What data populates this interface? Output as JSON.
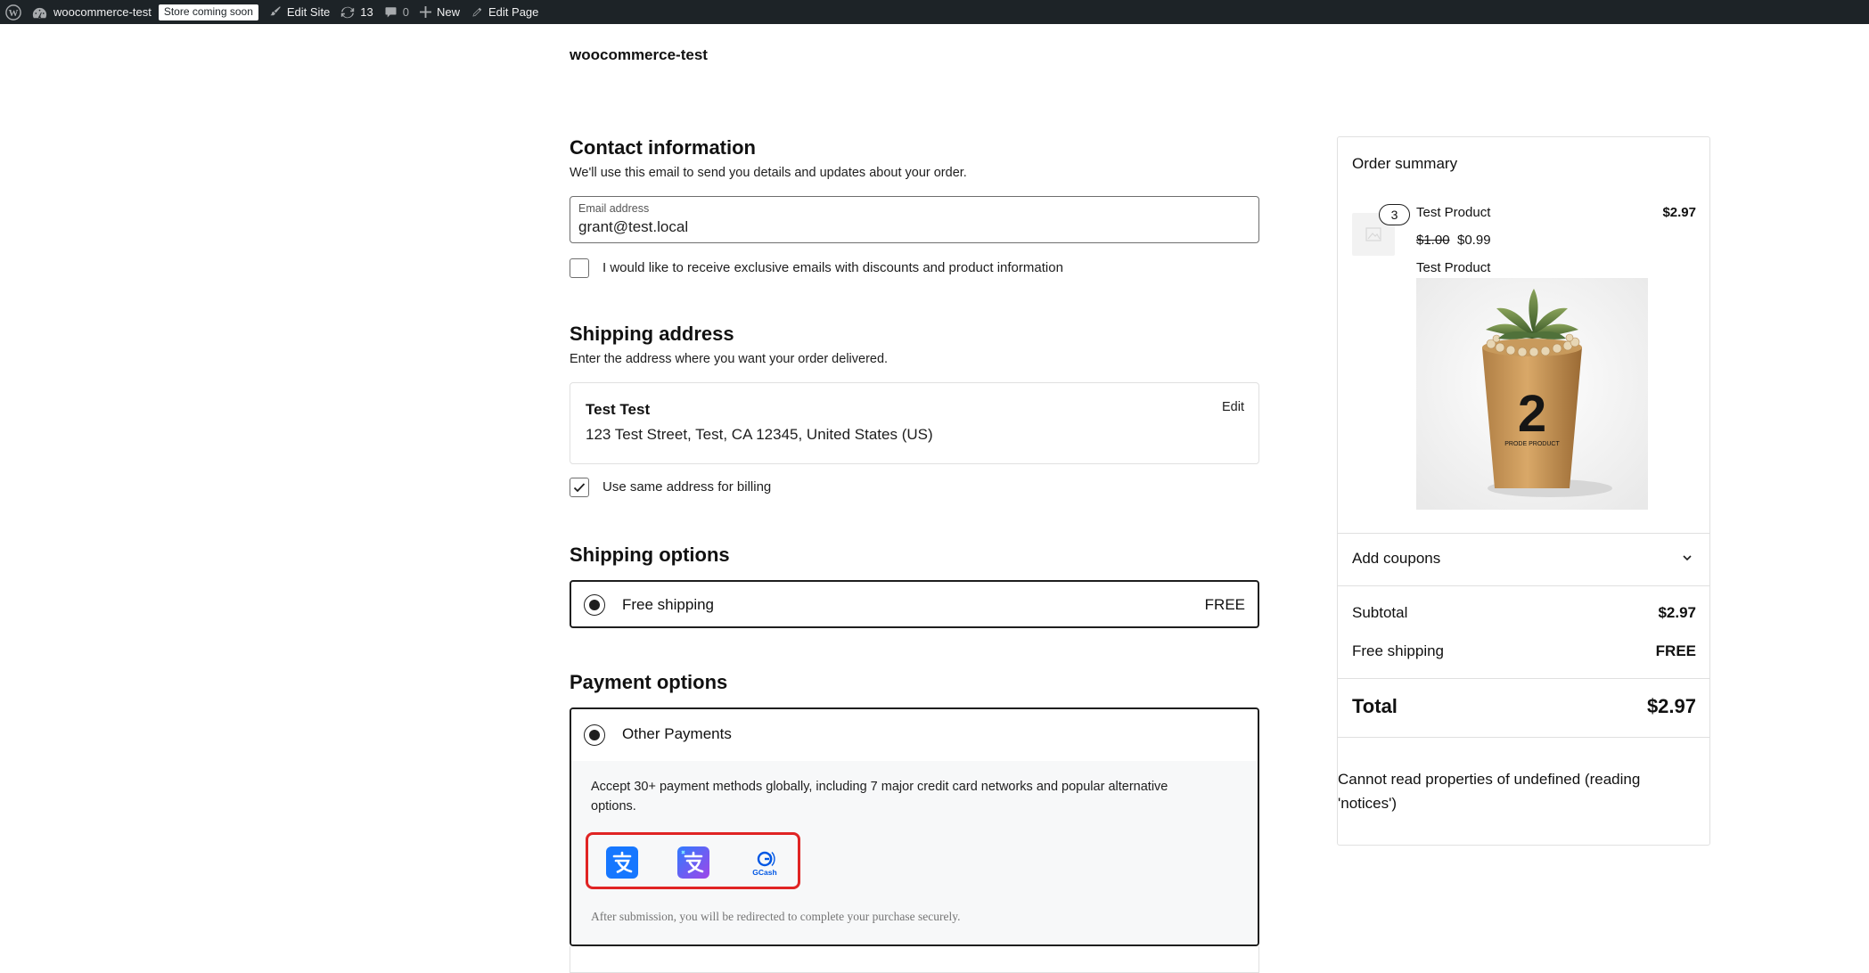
{
  "admin_bar": {
    "site_name": "woocommerce-test",
    "badge": "Store coming soon",
    "edit_site": "Edit Site",
    "updates_count": "13",
    "comments_count": "0",
    "new_label": "New",
    "edit_page": "Edit Page"
  },
  "site_title": "woocommerce-test",
  "contact": {
    "heading": "Contact information",
    "description": "We'll use this email to send you details and updates about your order.",
    "email_label": "Email address",
    "email_value": "grant@test.local",
    "newsletter_label": "I would like to receive exclusive emails with discounts and product information",
    "newsletter_checked": false
  },
  "shipping_address": {
    "heading": "Shipping address",
    "description": "Enter the address where you want your order delivered.",
    "name": "Test Test",
    "address": "123 Test Street, Test, CA 12345, United States (US)",
    "edit_label": "Edit",
    "same_billing_label": "Use same address for billing",
    "same_billing_checked": true
  },
  "shipping_options": {
    "heading": "Shipping options",
    "option_name": "Free shipping",
    "option_price": "FREE"
  },
  "payment_options": {
    "heading": "Payment options",
    "option_name": "Other Payments",
    "description": "Accept 30+ payment methods globally, including 7 major credit card networks and popular alternative options.",
    "methods": [
      "alipay-icon",
      "alipay-plus-icon",
      "gcash-icon"
    ],
    "gcash_text": "GCash",
    "note": "After submission, you will be redirected to complete your purchase securely."
  },
  "order_summary": {
    "title": "Order summary",
    "item": {
      "quantity": "3",
      "name": "Test Product",
      "line_total": "$2.97",
      "regular_price": "$1.00",
      "sale_price": "$0.99",
      "description": "Test Product",
      "image_text": "PRODE PRODUCT"
    },
    "coupons_label": "Add coupons",
    "subtotal_label": "Subtotal",
    "subtotal_value": "$2.97",
    "shipping_label": "Free shipping",
    "shipping_value": "FREE",
    "total_label": "Total",
    "total_value": "$2.97",
    "error": "Cannot read properties of undefined (reading 'notices')"
  },
  "colors": {
    "admin_bar_bg": "#1d2327",
    "highlight_border": "#e02424",
    "alipay_blue": "#1677ff",
    "gcash_blue": "#0057e4"
  }
}
